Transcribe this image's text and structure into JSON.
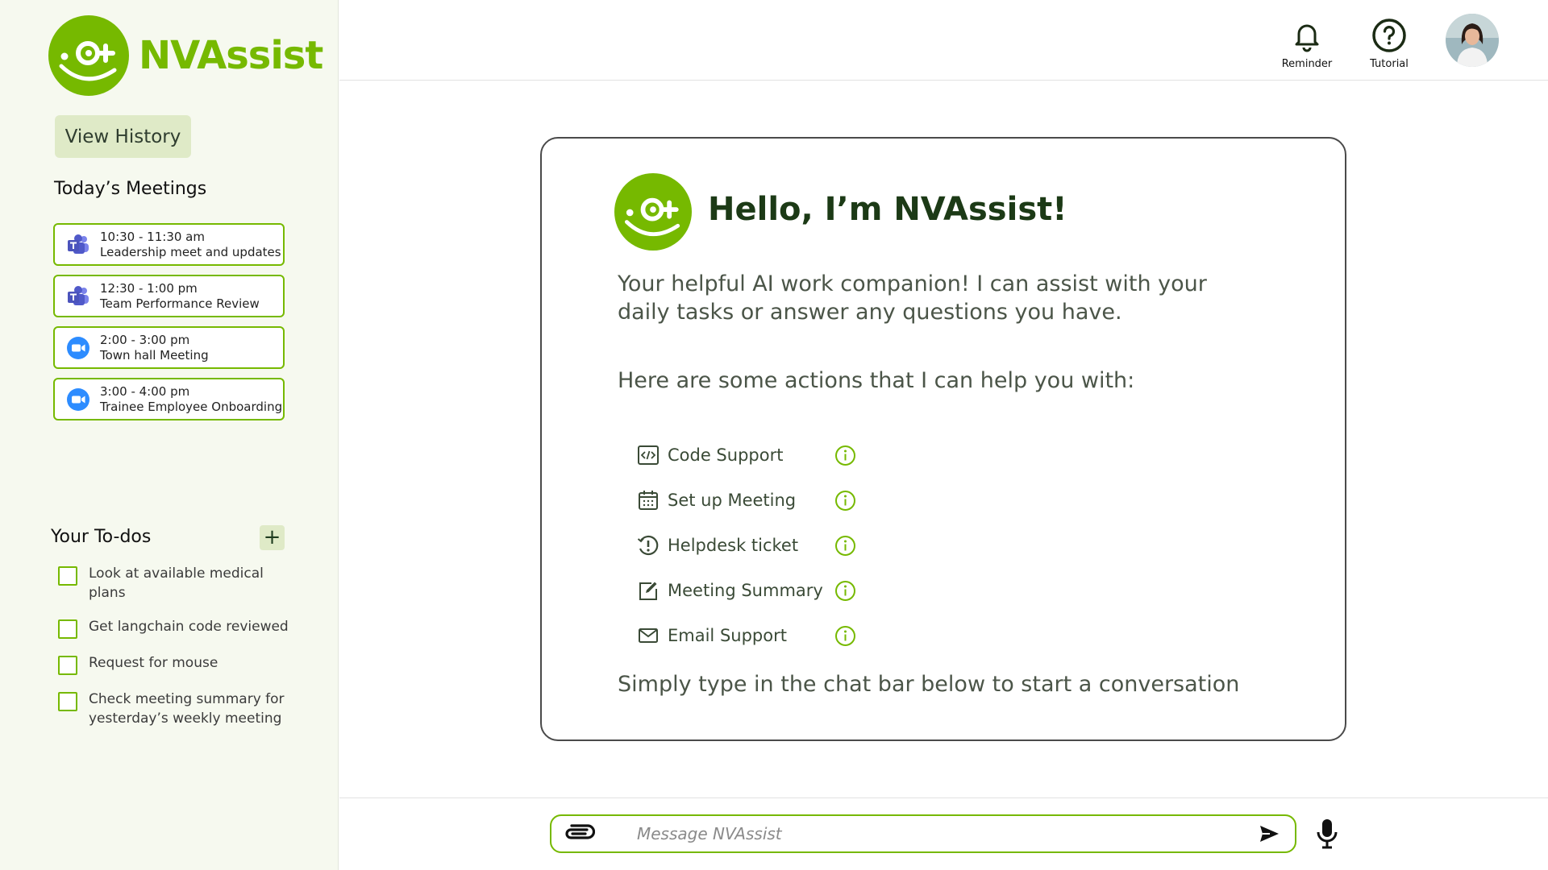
{
  "app": {
    "name": "NVAssist",
    "accent": "#76b900"
  },
  "sidebar": {
    "view_history_label": "View History",
    "meetings_title": "Today’s Meetings",
    "meetings": [
      {
        "time": "10:30 - 11:30 am",
        "title": "Leadership meet and updates",
        "icon": "teams-icon"
      },
      {
        "time": "12:30 - 1:00 pm",
        "title": "Team Performance Review",
        "icon": "teams-icon"
      },
      {
        "time": "2:00 - 3:00 pm",
        "title": "Town hall Meeting",
        "icon": "zoom-icon"
      },
      {
        "time": "3:00 - 4:00 pm",
        "title": "Trainee Employee Onboarding",
        "icon": "zoom-icon"
      }
    ],
    "todos_title": "Your To-dos",
    "add_todo_label": "+",
    "todos": [
      {
        "text": "Look at available medical plans",
        "checked": false
      },
      {
        "text": "Get langchain code reviewed",
        "checked": false
      },
      {
        "text": "Request for mouse",
        "checked": false
      },
      {
        "text": "Check meeting summary for yesterday’s weekly meeting",
        "checked": false
      }
    ]
  },
  "topbar": {
    "reminder_label": "Reminder",
    "tutorial_label": "Tutorial"
  },
  "welcome": {
    "title": "Hello, I’m NVAssist!",
    "intro": "Your helpful AI work companion! I can assist with your daily tasks or answer any questions you have.",
    "actions_intro": "Here are some actions that I can help you with:",
    "actions": [
      {
        "label": "Code Support",
        "icon": "code-icon"
      },
      {
        "label": "Set up Meeting",
        "icon": "calendar-icon"
      },
      {
        "label": "Helpdesk ticket",
        "icon": "helpdesk-icon"
      },
      {
        "label": "Meeting Summary",
        "icon": "edit-note-icon"
      },
      {
        "label": "Email Support",
        "icon": "email-icon"
      }
    ],
    "footer": "Simply type in the chat bar below to start a conversation"
  },
  "chat": {
    "placeholder": "Message NVAssist"
  }
}
